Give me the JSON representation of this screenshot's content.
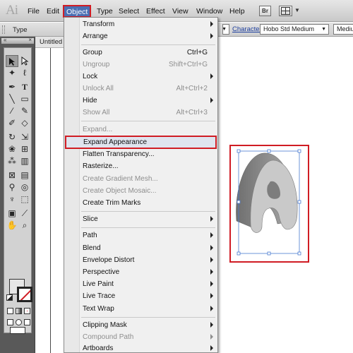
{
  "app": {
    "logo": "Ai"
  },
  "menubar": {
    "items": [
      "File",
      "Edit",
      "Object",
      "Type",
      "Select",
      "Effect",
      "View",
      "Window",
      "Help"
    ],
    "active": "Object",
    "bridge_icon": "Br"
  },
  "controlbar": {
    "label": "Type",
    "character_label": "Character:",
    "font_family": "Hobo Std Medium",
    "font_style": "Medium"
  },
  "document": {
    "tab_title": "Untitled"
  },
  "object_menu": {
    "items": [
      {
        "label": "Transform",
        "shortcut": "",
        "submenu": true,
        "enabled": true
      },
      {
        "label": "Arrange",
        "shortcut": "",
        "submenu": true,
        "enabled": true
      },
      {
        "label": "Group",
        "shortcut": "Ctrl+G",
        "submenu": false,
        "enabled": true
      },
      {
        "label": "Ungroup",
        "shortcut": "Shift+Ctrl+G",
        "submenu": false,
        "enabled": false
      },
      {
        "label": "Lock",
        "shortcut": "",
        "submenu": true,
        "enabled": true
      },
      {
        "label": "Unlock All",
        "shortcut": "Alt+Ctrl+2",
        "submenu": false,
        "enabled": false
      },
      {
        "label": "Hide",
        "shortcut": "",
        "submenu": true,
        "enabled": true
      },
      {
        "label": "Show All",
        "shortcut": "Alt+Ctrl+3",
        "submenu": false,
        "enabled": false
      },
      {
        "label": "Expand...",
        "shortcut": "",
        "submenu": false,
        "enabled": false
      },
      {
        "label": "Expand Appearance",
        "shortcut": "",
        "submenu": false,
        "enabled": true,
        "highlighted": true
      },
      {
        "label": "Flatten Transparency...",
        "shortcut": "",
        "submenu": false,
        "enabled": true
      },
      {
        "label": "Rasterize...",
        "shortcut": "",
        "submenu": false,
        "enabled": true
      },
      {
        "label": "Create Gradient Mesh...",
        "shortcut": "",
        "submenu": false,
        "enabled": false
      },
      {
        "label": "Create Object Mosaic...",
        "shortcut": "",
        "submenu": false,
        "enabled": false
      },
      {
        "label": "Create Trim Marks",
        "shortcut": "",
        "submenu": false,
        "enabled": true
      },
      {
        "label": "Slice",
        "shortcut": "",
        "submenu": true,
        "enabled": true
      },
      {
        "label": "Path",
        "shortcut": "",
        "submenu": true,
        "enabled": true
      },
      {
        "label": "Blend",
        "shortcut": "",
        "submenu": true,
        "enabled": true
      },
      {
        "label": "Envelope Distort",
        "shortcut": "",
        "submenu": true,
        "enabled": true
      },
      {
        "label": "Perspective",
        "shortcut": "",
        "submenu": true,
        "enabled": true
      },
      {
        "label": "Live Paint",
        "shortcut": "",
        "submenu": true,
        "enabled": true
      },
      {
        "label": "Live Trace",
        "shortcut": "",
        "submenu": true,
        "enabled": true
      },
      {
        "label": "Text Wrap",
        "shortcut": "",
        "submenu": true,
        "enabled": true
      },
      {
        "label": "Clipping Mask",
        "shortcut": "",
        "submenu": true,
        "enabled": true
      },
      {
        "label": "Compound Path",
        "shortcut": "",
        "submenu": true,
        "enabled": false
      },
      {
        "label": "Artboards",
        "shortcut": "",
        "submenu": true,
        "enabled": true
      }
    ]
  },
  "colors": {
    "annotation_red": "#d01c24",
    "menu_active": "#4b6fb3",
    "selection_blue": "#4a7bd0"
  }
}
